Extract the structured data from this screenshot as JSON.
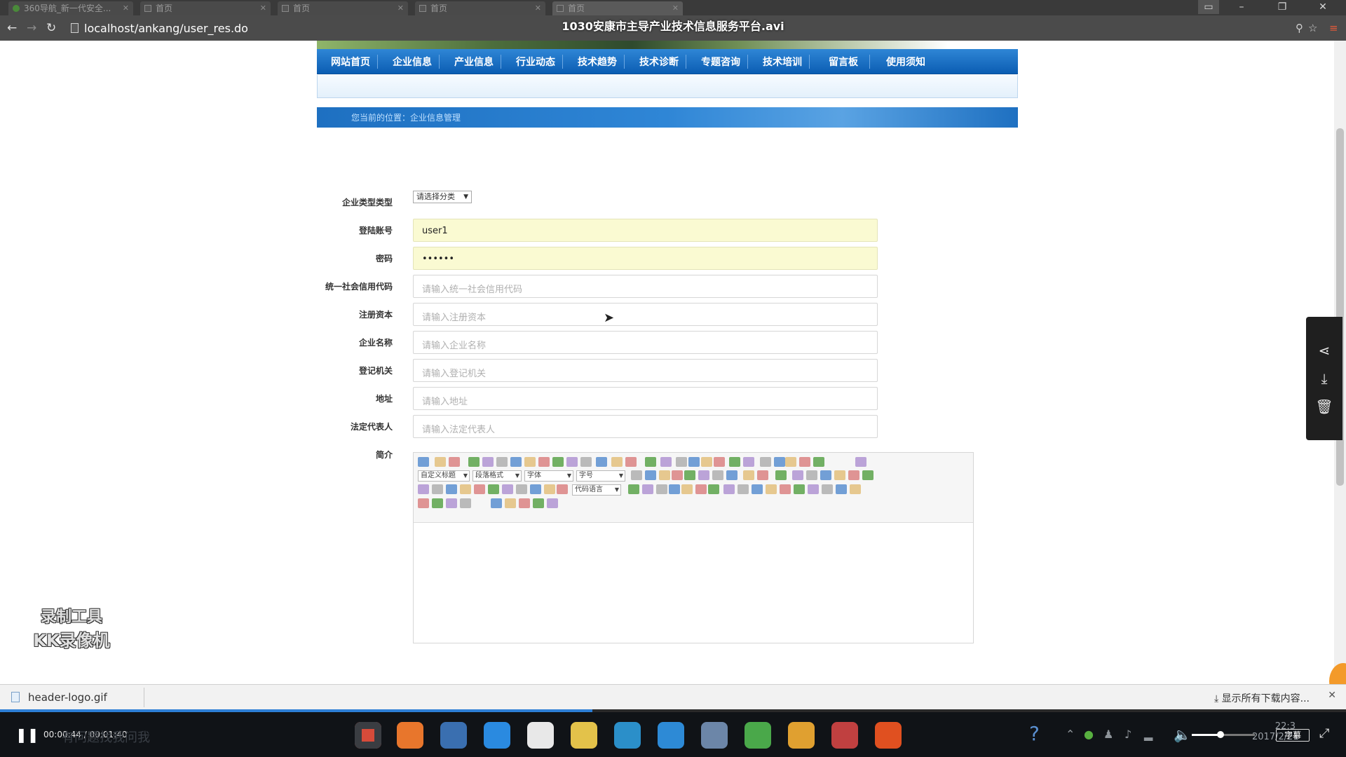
{
  "player": {
    "title": "1030安康市主导产业技术信息服务平台.avi",
    "time": "00:00:44 / 00:01:40",
    "progress": 0.44,
    "volume": 0.45,
    "subtitle_label": "字幕",
    "ghost_text": "有问题找我问我",
    "clock_time": "22:3",
    "clock_date": "2017/2/21"
  },
  "browser": {
    "tabs": [
      {
        "label": "360导航_新一代安全...",
        "active": false
      },
      {
        "label": "首页",
        "active": false
      },
      {
        "label": "首页",
        "active": false
      },
      {
        "label": "首页",
        "active": false
      },
      {
        "label": "首页",
        "active": true
      }
    ],
    "url": "localhost/ankang/user_res.do"
  },
  "site": {
    "nav": [
      "网站首页",
      "企业信息",
      "产业信息",
      "行业动态",
      "技术趋势",
      "技术诊断",
      "专题咨询",
      "技术培训",
      "留言板",
      "使用须知"
    ],
    "breadcrumb": "您当前的位置：企业信息管理"
  },
  "form": {
    "type_label": "企业类型类型",
    "type_value": "请选择分类",
    "fields": [
      {
        "label": "登陆账号",
        "value": "user1",
        "placeholder": ""
      },
      {
        "label": "密码",
        "value": "••••••",
        "placeholder": ""
      },
      {
        "label": "统一社会信用代码",
        "value": "",
        "placeholder": "请输入统一社会信用代码"
      },
      {
        "label": "注册资本",
        "value": "",
        "placeholder": "请输入注册资本"
      },
      {
        "label": "企业名称",
        "value": "",
        "placeholder": "请输入企业名称"
      },
      {
        "label": "登记机关",
        "value": "",
        "placeholder": "请输入登记机关"
      },
      {
        "label": "地址",
        "value": "",
        "placeholder": "请输入地址"
      },
      {
        "label": "法定代表人",
        "value": "",
        "placeholder": "请输入法定代表人"
      }
    ],
    "intro_label": "简介"
  },
  "editor": {
    "sel_custom_title": "自定义标题",
    "sel_paragraph": "段落格式",
    "sel_font": "字体",
    "sel_size": "字号",
    "sel_code_lang": "代码语言",
    "icon_colors": [
      "#5b8fd0",
      "#d9a23a",
      "#cc4444",
      "#5aa34a",
      "#8a5fc0",
      "#888888"
    ]
  },
  "side_panel": {
    "icons": [
      "share-icon",
      "download-icon",
      "delete-icon"
    ]
  },
  "watermark": {
    "line1": "录制工具",
    "line2": "KK录像机"
  },
  "downloads": {
    "file": "header-logo.gif",
    "show_all": "显示所有下载内容..."
  },
  "taskbar": {
    "apps": [
      "chrome-icon",
      "firefox-icon",
      "browser-icon",
      "ie-icon",
      "store-icon",
      "app-icon",
      "k-icon",
      "w-icon",
      "code-icon",
      "leaf-icon",
      "game-icon",
      "book-icon",
      "face-icon"
    ],
    "colors": [
      "#d64b3a",
      "#e8762c",
      "#3a6fb0",
      "#2a8ae0",
      "#e8e8e8",
      "#e3c24a",
      "#2b8fc9",
      "#2d8ad6",
      "#6c86a8",
      "#4aa84a",
      "#e0a030",
      "#c04040",
      "#e05020"
    ]
  }
}
